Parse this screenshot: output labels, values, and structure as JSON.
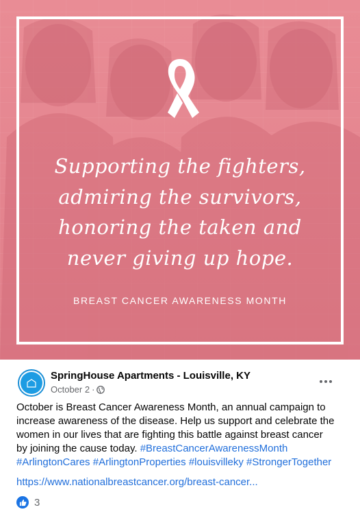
{
  "hero": {
    "quote_lines": [
      "Supporting the fighters,",
      "admiring the survivors,",
      "honoring the taken and",
      "never giving up hope."
    ],
    "subtitle": "BREAST CANCER AWARENESS MONTH",
    "icon": "ribbon-icon",
    "tint_color": "#e58690"
  },
  "post": {
    "page_name": "SpringHouse Apartments - Louisville, KY",
    "date": "October 2",
    "separator": "·",
    "privacy_icon": "globe-icon",
    "more_icon": "more-options-icon",
    "text_lines": [
      "October is Breast Cancer Awareness Month, an annual campaign to",
      "increase awareness of the disease. Help us support and celebrate the",
      "women in our lives that are fighting this battle against breast cancer",
      "by joining the cause today. "
    ],
    "hashtags": {
      "h1": "#BreastCancerAwarenessMonth",
      "h2": "#ArlingtonCares",
      "h3": "#ArlingtonProperties",
      "h4": "#louisvilleky",
      "h5": "#StrongerTogether"
    },
    "link": "https://www.nationalbreastcancer.org/breast-cancer...",
    "reaction_icon": "like-icon",
    "reaction_count": "3",
    "colors": {
      "link": "#216fdb",
      "meta": "#65676b",
      "like": "#1b74e4"
    }
  }
}
